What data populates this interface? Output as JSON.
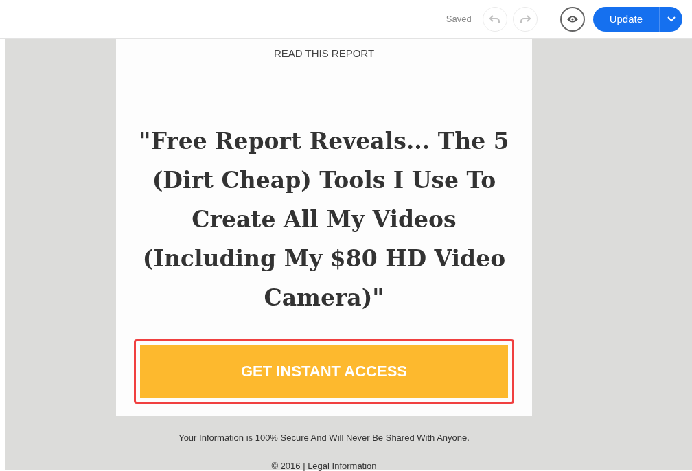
{
  "toolbar": {
    "status": "Saved",
    "undo": {
      "disabled": true
    },
    "redo": {
      "disabled": true
    },
    "update_label": "Update"
  },
  "card": {
    "eyebrow": "READ THIS REPORT",
    "headline": "\"Free Report Reveals... The 5 (Dirt Cheap) Tools I Use To Create All My Videos (Including My $80 HD Video Camera)\"",
    "cta": {
      "label": "GET INSTANT ACCESS",
      "selected": true
    }
  },
  "footer": {
    "notice": "Your Information is 100% Secure And Will Never Be Shared With Anyone.",
    "copyright": "© 2016 | ",
    "link": "Legal Information"
  }
}
